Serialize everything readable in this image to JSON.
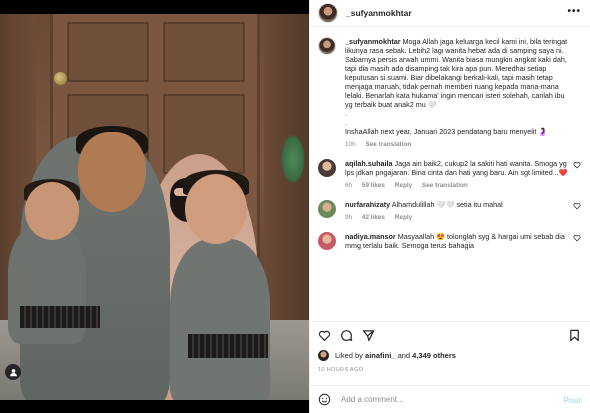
{
  "header": {
    "username": "_sufyanmokhtar",
    "more_label": "•••"
  },
  "caption": {
    "username": "_sufyanmokhtar",
    "text": "Moga Allah jaga keluarga kecil kami ini, bila teringat likunya rasa sebak. Lebih2 lagi wanita hebat ada di samping saya ni. Sabarnya persis arwah ummi. Wanita biasa mungkin angkat kaki dah, tapi dia masih ada disamping tak kira apa pun. Meredhai setiap keputusan si suami. Biar dibelakangi berkali-kali, tapi masih tetap menjaga maruah, tidak pernah memberi ruang kepada mana-mana lelaki. Benarlah kata hukama' ingin mencari isteri solehah, carilah ibu yg terbaik buat anak2 mu 🤍\n.\n.\nInshaAllah next year, Januari 2023 pendatang baru menyelit 🤰🏻",
    "time": "10h",
    "see_translation": "See translation"
  },
  "comments": [
    {
      "username": "aqilah.suhaila",
      "text": "Jaga ain baik2, cukup2 la sakiti hati wanita. Smoga yg lps jdkan pngajaran. Bina cinta dan hati yang baru. Ain sgt limited ..❤️",
      "time": "6h",
      "likes": "59 likes",
      "reply": "Reply",
      "see_translation": "See translation"
    },
    {
      "username": "nurfarahizaty",
      "text": "Alhamdulillah 🤍🤍 setia itu mahal",
      "time": "9h",
      "likes": "42 likes",
      "reply": "Reply",
      "see_translation": ""
    },
    {
      "username": "nadiya.mansor",
      "text": "Masyaallah 😍 tolonglah syg & hargai umi sebab dia mmg terlalu baik. Semoga terus bahagia",
      "time": "",
      "likes": "",
      "reply": "",
      "see_translation": ""
    }
  ],
  "actions": {
    "like_icon": "heart-icon",
    "comment_icon": "comment-icon",
    "share_icon": "paper-plane-icon",
    "save_icon": "bookmark-icon"
  },
  "likes": {
    "prefix": "Liked by ",
    "user": "ainafini_",
    "middle": " and ",
    "others": "4,349 others"
  },
  "time_ago": "10 HOURS AGO",
  "add_comment": {
    "placeholder": "Add a comment...",
    "post_label": "Post"
  },
  "colors": {
    "text": "#262626",
    "muted": "#8e8e8e",
    "link_disabled": "#b2dffc",
    "border": "#efefef"
  }
}
